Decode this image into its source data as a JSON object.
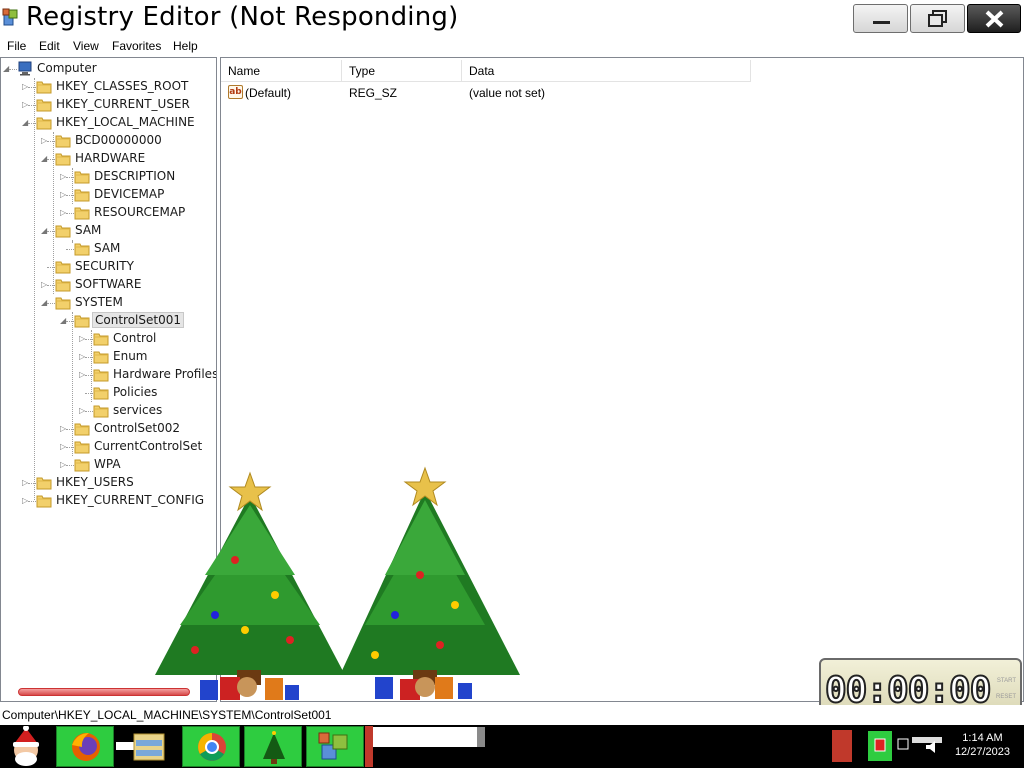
{
  "window": {
    "title": "Registry Editor (Not Responding)"
  },
  "menu": {
    "file": "File",
    "edit": "Edit",
    "view": "View",
    "favorites": "Favorites",
    "help": "Help"
  },
  "tree": {
    "items": [
      {
        "label": "Computer",
        "icon": "computer-icon",
        "toggle": "expanded"
      },
      {
        "label": "HKEY_CLASSES_ROOT",
        "icon": "folder-icon",
        "toggle": "collapsed"
      },
      {
        "label": "HKEY_CURRENT_USER",
        "icon": "folder-icon",
        "toggle": "collapsed"
      },
      {
        "label": "HKEY_LOCAL_MACHINE",
        "icon": "folder-icon",
        "toggle": "expanded"
      },
      {
        "label": "BCD00000000",
        "icon": "folder-icon",
        "toggle": "collapsed"
      },
      {
        "label": "HARDWARE",
        "icon": "folder-icon",
        "toggle": "expanded"
      },
      {
        "label": "DESCRIPTION",
        "icon": "folder-icon",
        "toggle": "collapsed"
      },
      {
        "label": "DEVICEMAP",
        "icon": "folder-icon",
        "toggle": "collapsed"
      },
      {
        "label": "RESOURCEMAP",
        "icon": "folder-icon",
        "toggle": "collapsed"
      },
      {
        "label": "SAM",
        "icon": "folder-icon",
        "toggle": "expanded"
      },
      {
        "label": "SAM",
        "icon": "folder-icon",
        "toggle": "none"
      },
      {
        "label": "SECURITY",
        "icon": "folder-icon",
        "toggle": "none"
      },
      {
        "label": "SOFTWARE",
        "icon": "folder-icon",
        "toggle": "collapsed"
      },
      {
        "label": "SYSTEM",
        "icon": "folder-icon",
        "toggle": "expanded"
      },
      {
        "label": "ControlSet001",
        "icon": "folder-icon",
        "toggle": "expanded",
        "selected": true
      },
      {
        "label": "Control",
        "icon": "folder-icon",
        "toggle": "collapsed"
      },
      {
        "label": "Enum",
        "icon": "folder-icon",
        "toggle": "collapsed"
      },
      {
        "label": "Hardware Profiles",
        "icon": "folder-icon",
        "toggle": "collapsed"
      },
      {
        "label": "Policies",
        "icon": "folder-icon",
        "toggle": "none"
      },
      {
        "label": "services",
        "icon": "folder-icon",
        "toggle": "collapsed"
      },
      {
        "label": "ControlSet002",
        "icon": "folder-icon",
        "toggle": "collapsed"
      },
      {
        "label": "CurrentControlSet",
        "icon": "folder-icon",
        "toggle": "collapsed"
      },
      {
        "label": "WPA",
        "icon": "folder-icon",
        "toggle": "collapsed"
      },
      {
        "label": "HKEY_USERS",
        "icon": "folder-icon",
        "toggle": "collapsed"
      },
      {
        "label": "HKEY_CURRENT_CONFIG",
        "icon": "folder-icon",
        "toggle": "collapsed"
      }
    ]
  },
  "list": {
    "columns": [
      "Name",
      "Type",
      "Data"
    ],
    "rows": [
      {
        "name": "(Default)",
        "type": "REG_SZ",
        "data": "(value not set)",
        "icon": "string-value-icon"
      }
    ]
  },
  "timer": {
    "display": "00:00:00",
    "start_label": "START",
    "reset_label": "RESET"
  },
  "statusbar": {
    "path": "Computer\\HKEY_LOCAL_MACHINE\\SYSTEM\\ControlSet001"
  },
  "taskbar": {
    "time": "1:14 AM",
    "date": "12/27/2023",
    "apps": [
      "santa-start-icon",
      "firefox-icon",
      "file-explorer-icon",
      "chrome-icon",
      "christmas-tree-icon",
      "registry-editor-icon"
    ]
  },
  "colors": {
    "taskbar_bg": "#000000",
    "taskbar_highlight": "#2ecc40",
    "selection": "#e5e5e5"
  }
}
